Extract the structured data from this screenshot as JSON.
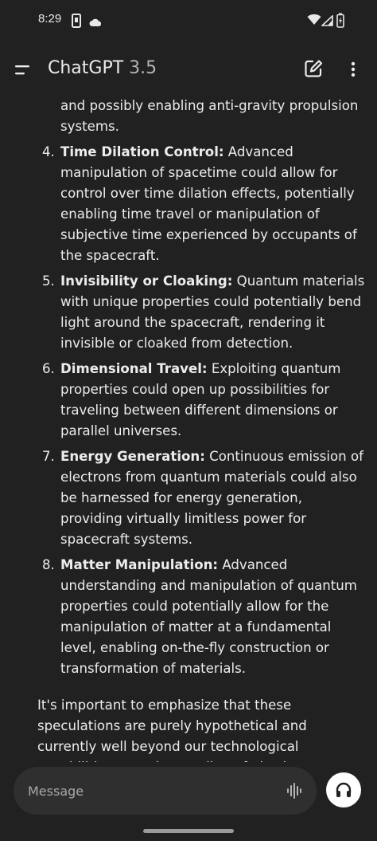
{
  "status_bar": {
    "time": "8:29"
  },
  "app_bar": {
    "title": "ChatGPT",
    "model_version": "3.5"
  },
  "message": {
    "continued_text": "and possibly enabling anti-gravity propulsion systems.",
    "items": [
      {
        "number": "4.",
        "title": "Time Dilation Control:",
        "text": " Advanced manipulation of spacetime could allow for control over time dilation effects, potentially enabling time travel or manipulation of subjective time experienced by occupants of the spacecraft."
      },
      {
        "number": "5.",
        "title": "Invisibility or Cloaking:",
        "text": " Quantum materials with unique properties could potentially bend light around the spacecraft, rendering it invisible or cloaked from detection."
      },
      {
        "number": "6.",
        "title": "Dimensional Travel:",
        "text": " Exploiting quantum properties could open up possibilities for traveling between different dimensions or parallel universes."
      },
      {
        "number": "7.",
        "title": "Energy Generation:",
        "text": " Continuous emission of electrons from quantum materials could also be harnessed for energy generation, providing virtually limitless power for spacecraft systems."
      },
      {
        "number": "8.",
        "title": "Matter Manipulation:",
        "text": " Advanced understanding and manipulation of quantum properties could potentially allow for the manipulation of matter at a fundamental level, enabling on-the-fly construction or transformation of materials."
      }
    ],
    "closing": "It's important to emphasize that these speculations are purely hypothetical and currently well beyond our technological capabilities or understanding of physics. However, they do capture the imaginative potential of such a revolutionary technology."
  },
  "composer": {
    "placeholder": "Message"
  },
  "icons": {
    "menu": "menu-icon",
    "new_chat": "edit-icon",
    "more": "more-vertical-icon",
    "voice": "waveform-icon",
    "voice_mode": "headphones-icon"
  }
}
